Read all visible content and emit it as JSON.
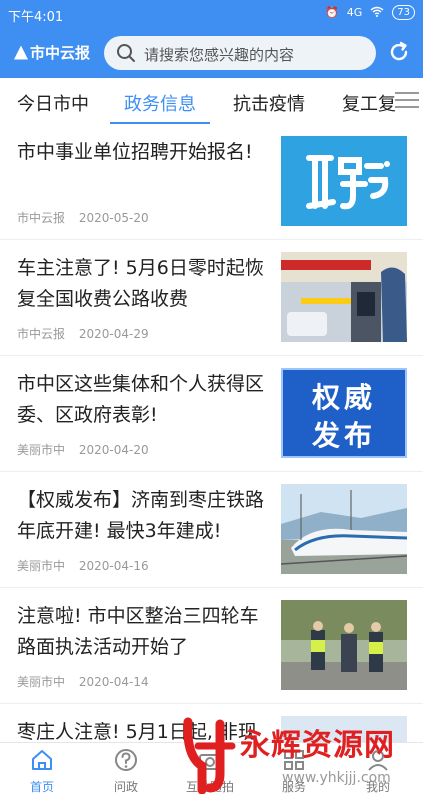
{
  "status_bar": {
    "time": "下午4:01",
    "network": "4G",
    "battery": "73"
  },
  "header": {
    "logo": "市中云报",
    "search_placeholder": "请搜索您感兴趣的内容"
  },
  "tabs": [
    {
      "label": "今日市中",
      "active": false
    },
    {
      "label": "政务信息",
      "active": true
    },
    {
      "label": "抗击疫情",
      "active": false
    },
    {
      "label": "复工复",
      "active": false
    }
  ],
  "articles": [
    {
      "title": "市中事业单位招聘开始报名!",
      "source": "市中云报",
      "date": "2020-05-20",
      "thumb": "聘"
    },
    {
      "title": "车主注意了! 5月6日零时起恢复全国收费公路收费",
      "source": "市中云报",
      "date": "2020-04-29",
      "thumb": "toll-gate-photo"
    },
    {
      "title": "市中区这些集体和个人获得区委、区政府表彰!",
      "source": "美丽市中",
      "date": "2020-04-20",
      "thumb_line1": "权威",
      "thumb_line2": "发布"
    },
    {
      "title": "【权威发布】济南到枣庄铁路年底开建! 最快3年建成!",
      "source": "美丽市中",
      "date": "2020-04-16",
      "thumb": "train-photo"
    },
    {
      "title": "注意啦! 市中区整治三四轮车路面执法活动开始了",
      "source": "美丽市中",
      "date": "2020-04-14",
      "thumb": "police-photo"
    },
    {
      "title": "枣庄人注意! 5月1日起, 非现",
      "source": "",
      "date": "",
      "thumb": "sky-photo"
    }
  ],
  "bottom_nav": [
    {
      "label": "首页",
      "active": true,
      "icon": "home-icon"
    },
    {
      "label": "问政",
      "active": false,
      "icon": "question-icon"
    },
    {
      "label": "互动随拍",
      "active": false,
      "icon": "camera-icon"
    },
    {
      "label": "服务",
      "active": false,
      "icon": "grid-icon"
    },
    {
      "label": "我的",
      "active": false,
      "icon": "user-icon"
    }
  ],
  "watermark": {
    "text": "永辉资源网",
    "url": "www.yhkjjj.com"
  },
  "colors": {
    "primary": "#3f8ff3",
    "watermark": "#e02020"
  }
}
